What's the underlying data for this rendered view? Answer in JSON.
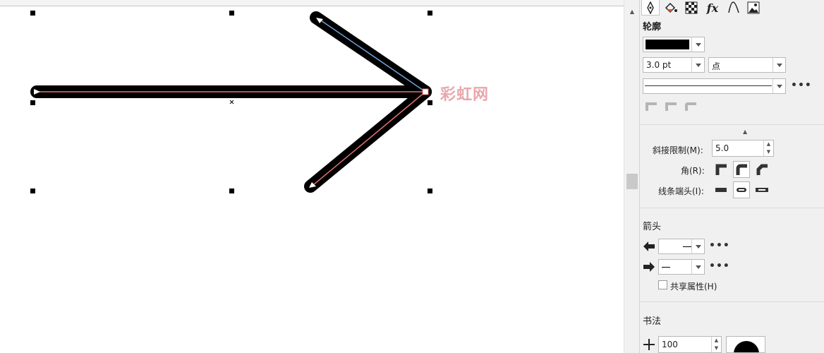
{
  "window": {
    "title": ""
  },
  "watermark": {
    "text": "彩虹网"
  },
  "panel": {
    "tabs": [
      {
        "name": "outline-pen-icon"
      },
      {
        "name": "fill-icon"
      },
      {
        "name": "transparency-icon"
      },
      {
        "name": "effects-fx-icon"
      },
      {
        "name": "curve-icon"
      },
      {
        "name": "bitmap-icon"
      }
    ],
    "outline": {
      "title": "轮廓",
      "color": "#000000",
      "width_value": "3.0 pt",
      "unit_value": "点",
      "more": "•••"
    },
    "miter": {
      "label": "斜接限制(M):",
      "value": "5.0"
    },
    "corner": {
      "label": "角(R):"
    },
    "linecap": {
      "label": "线条端头(I):"
    },
    "arrows": {
      "title": "箭头",
      "shared_label": "共享属性(H)",
      "more": "•••"
    },
    "calligraphy": {
      "title": "书法",
      "stretch_value": "100"
    }
  },
  "colors": {
    "panel_bg": "#f0f0f0",
    "accent_red": "#e07070",
    "accent_blue": "#6fa0d8"
  }
}
